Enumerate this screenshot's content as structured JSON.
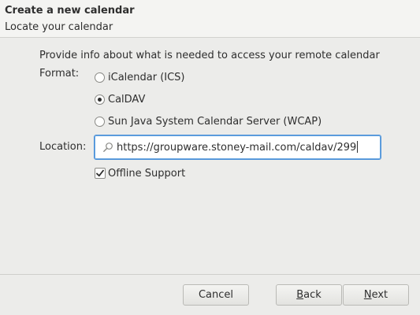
{
  "header": {
    "title": "Create a new calendar",
    "subtitle": "Locate your calendar"
  },
  "form": {
    "description": "Provide info about what is needed to access your remote calendar",
    "format_label": "Format:",
    "format_options": [
      {
        "label": "iCalendar (ICS)",
        "checked": false
      },
      {
        "label": "CalDAV",
        "checked": true
      },
      {
        "label": "Sun Java System Calendar Server (WCAP)",
        "checked": false
      }
    ],
    "location_label": "Location:",
    "location_value": "https://groupware.stoney-mail.com/caldav/299",
    "location_icon": "search-icon",
    "offline_label": "Offline Support",
    "offline_checked": true
  },
  "buttons": {
    "cancel": "Cancel",
    "back_mnemonic": "B",
    "back_rest": "ack",
    "next_mnemonic": "N",
    "next_rest": "ext"
  },
  "colors": {
    "focus_border": "#4a90d9",
    "background": "#ececea"
  }
}
